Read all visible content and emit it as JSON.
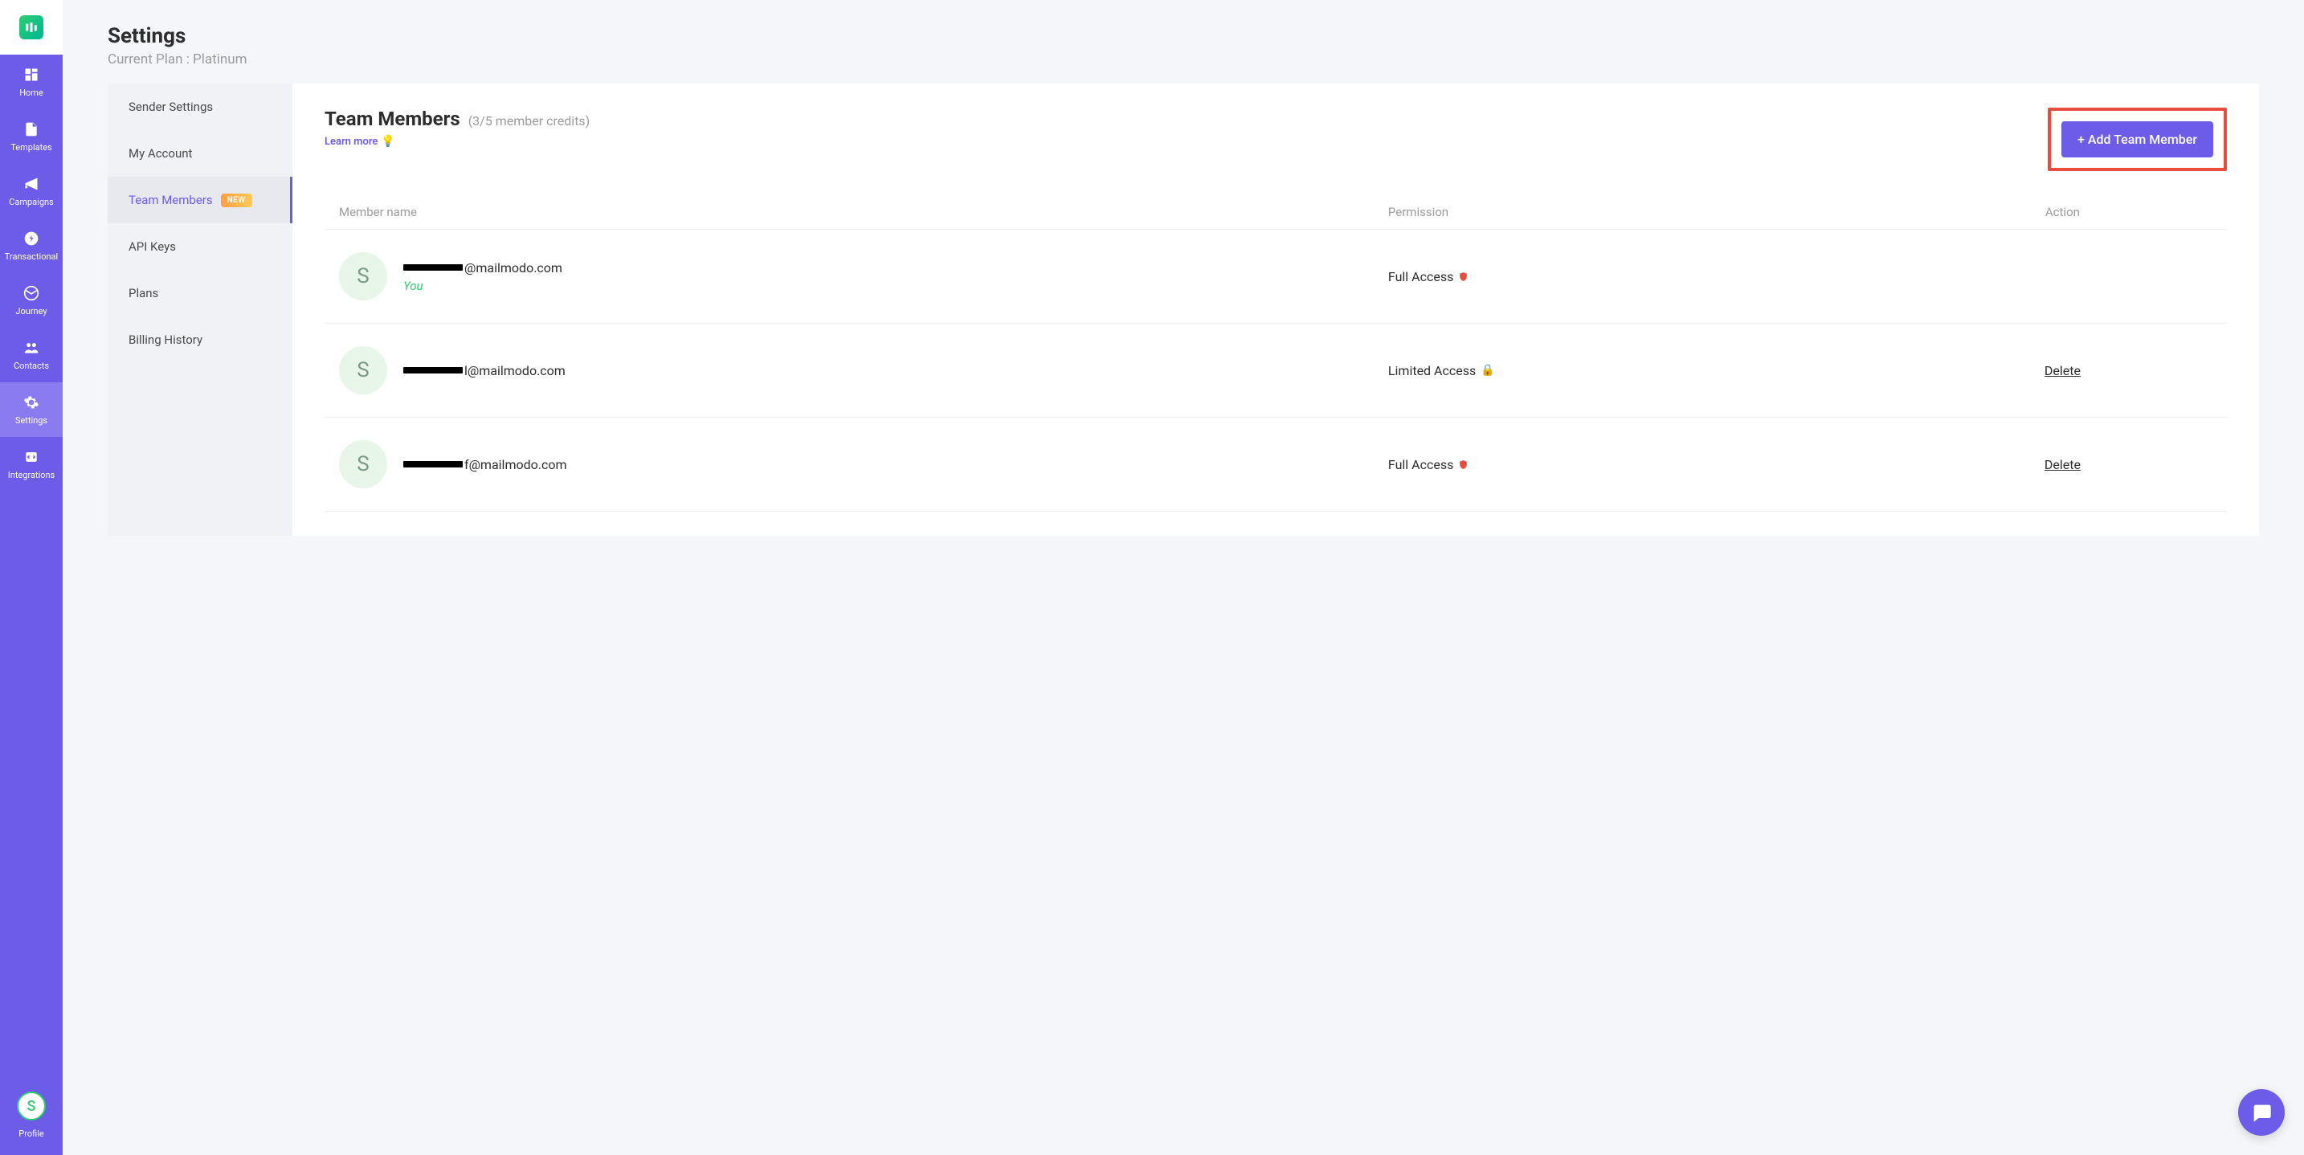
{
  "brand": {
    "logo_letter": ""
  },
  "sidebar": [
    {
      "id": "home",
      "label": "Home"
    },
    {
      "id": "templates",
      "label": "Templates"
    },
    {
      "id": "campaigns",
      "label": "Campaigns"
    },
    {
      "id": "transactional",
      "label": "Transactional"
    },
    {
      "id": "journey",
      "label": "Journey"
    },
    {
      "id": "contacts",
      "label": "Contacts"
    },
    {
      "id": "settings",
      "label": "Settings",
      "active": true
    },
    {
      "id": "integrations",
      "label": "Integrations"
    }
  ],
  "profile": {
    "initial": "S",
    "label": "Profile"
  },
  "header": {
    "title": "Settings",
    "plan_line": "Current Plan : Platinum"
  },
  "settings_nav": [
    {
      "id": "sender",
      "label": "Sender Settings"
    },
    {
      "id": "account",
      "label": "My Account"
    },
    {
      "id": "team",
      "label": "Team Members",
      "badge": "NEW",
      "active": true
    },
    {
      "id": "api",
      "label": "API Keys"
    },
    {
      "id": "plans",
      "label": "Plans"
    },
    {
      "id": "billing",
      "label": "Billing History"
    }
  ],
  "panel": {
    "title": "Team Members",
    "credits": "(3/5 member credits)",
    "learn_more": "Learn more",
    "add_button": "+ Add Team Member"
  },
  "table": {
    "headers": {
      "name": "Member name",
      "permission": "Permission",
      "action": "Action"
    },
    "rows": [
      {
        "initial": "S",
        "email_suffix": "@mailmodo.com",
        "you": "You",
        "permission": "Full Access",
        "perm_icon": "shield",
        "action": ""
      },
      {
        "initial": "S",
        "email_suffix": "l@mailmodo.com",
        "you": "",
        "permission": "Limited Access",
        "perm_icon": "lock",
        "action": "Delete"
      },
      {
        "initial": "S",
        "email_suffix": "f@mailmodo.com",
        "you": "",
        "permission": "Full Access",
        "perm_icon": "shield",
        "action": "Delete"
      }
    ]
  }
}
